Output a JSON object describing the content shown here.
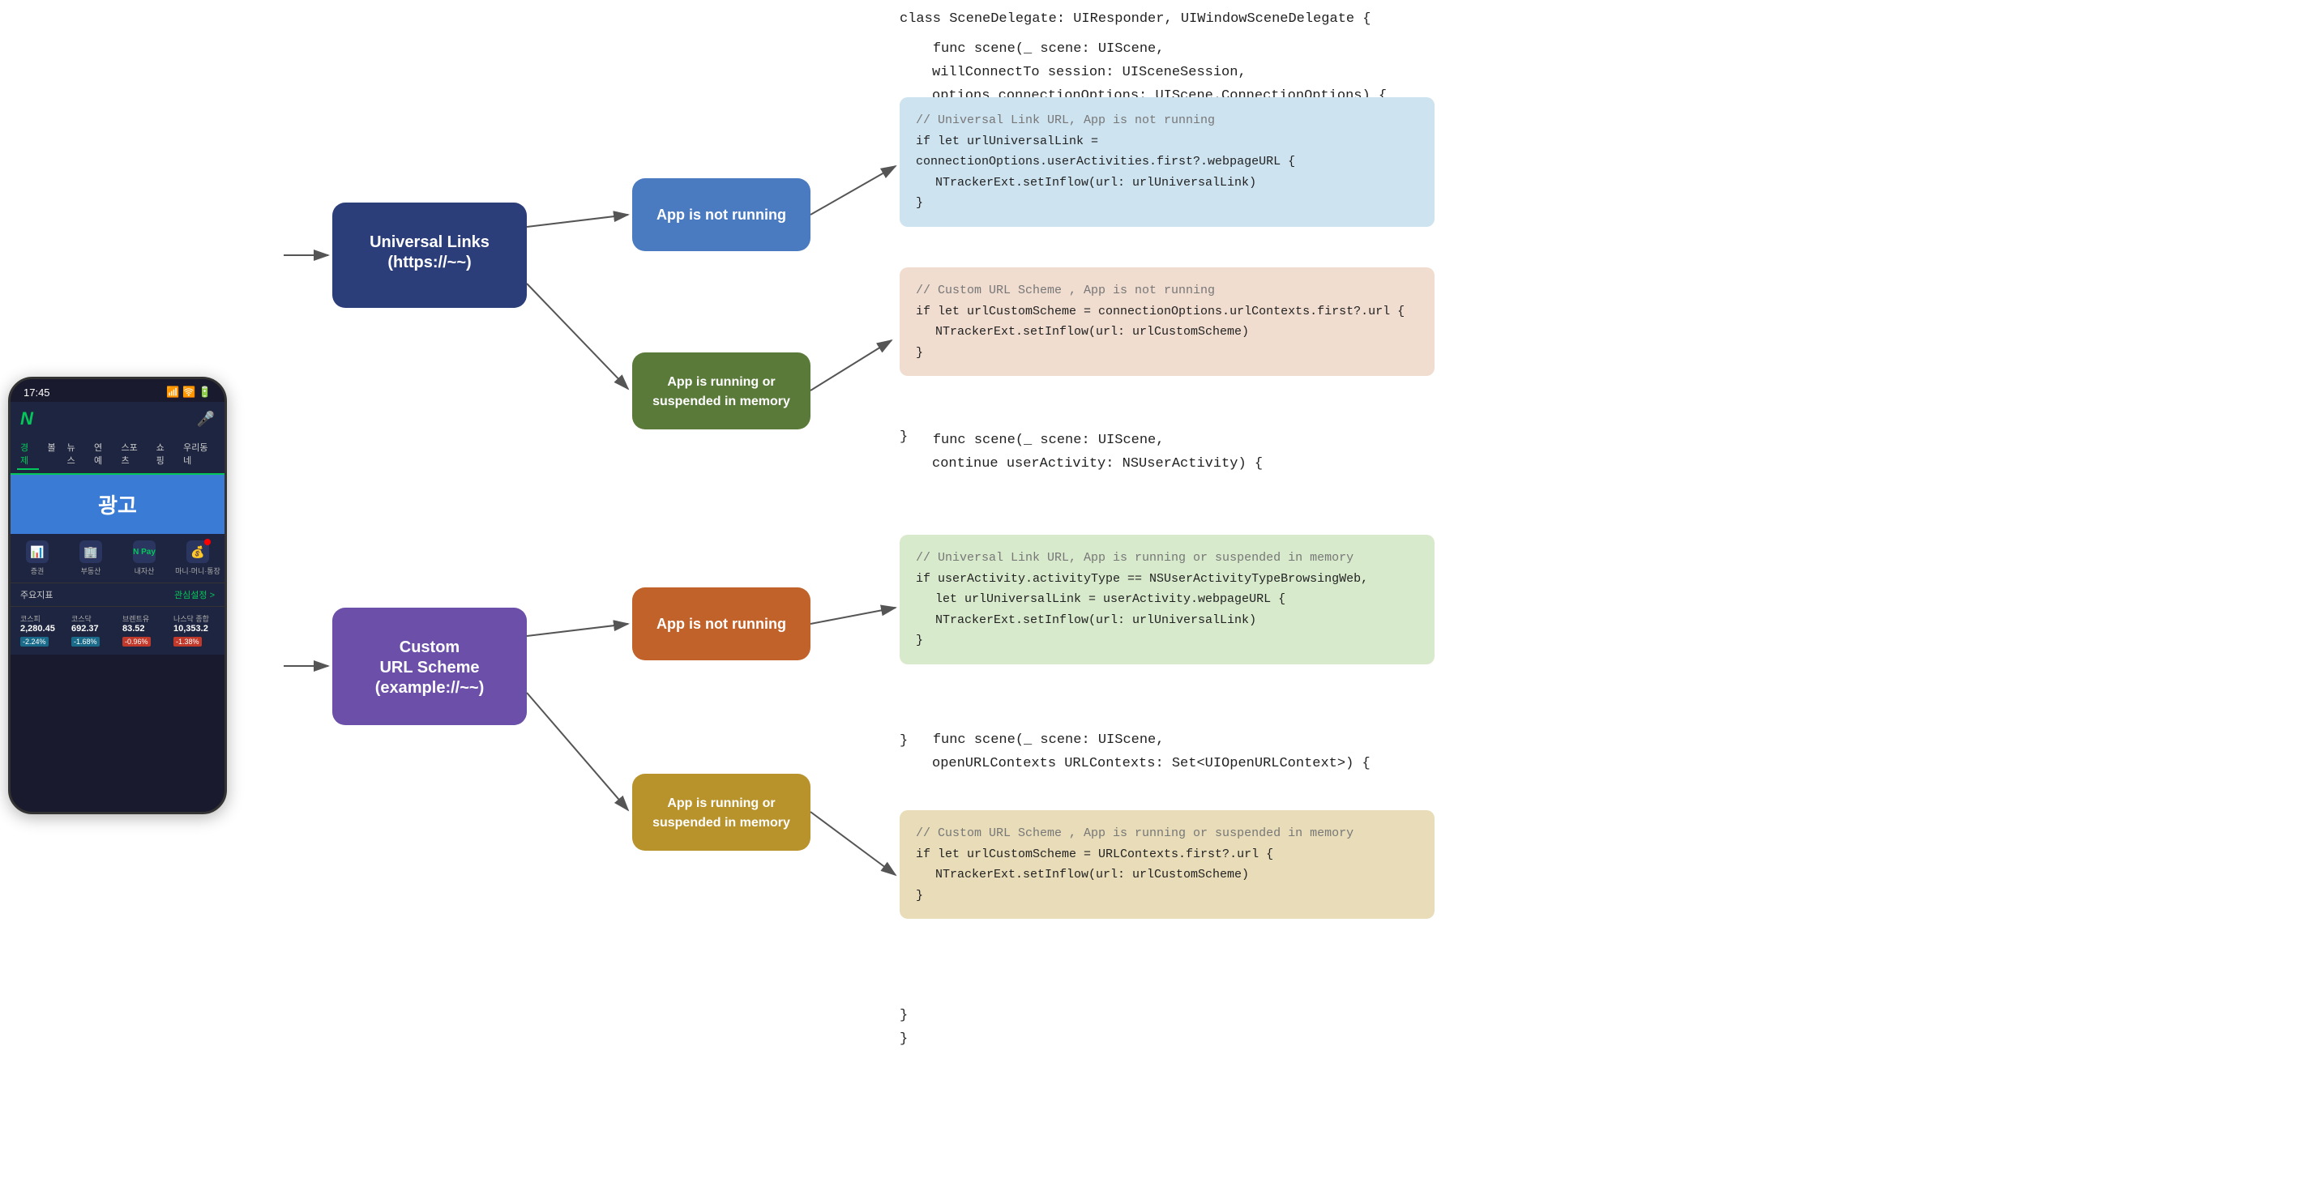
{
  "phone": {
    "time": "17:45",
    "logo": "N",
    "menu_items": [
      "경제",
      "볼",
      "뉴스",
      "연예",
      "스포츠",
      "쇼핑",
      "우리동네",
      "≡"
    ],
    "ad_text": "광고",
    "icons": [
      {
        "label": "증권",
        "icon": "📊"
      },
      {
        "label": "부동산",
        "icon": "🏢"
      },
      {
        "label": "내자산",
        "icon": "💳"
      },
      {
        "label": "마니·머니·통장",
        "icon": "💰",
        "badge": true
      }
    ],
    "section_title": "주요지표",
    "section_action": "관심설정 >",
    "stocks": [
      {
        "name": "코스피",
        "value": "2,280.45",
        "change": "-2.24%",
        "type": "negative"
      },
      {
        "name": "코스닥",
        "value": "692.37",
        "change": "-1.68%",
        "type": "negative"
      },
      {
        "name": "브렌트유",
        "value": "83.52",
        "change": "-0.96%",
        "type": "more-negative"
      },
      {
        "name": "나스닥 종합",
        "value": "10,353.2",
        "change": "-1.38%",
        "type": "more-negative"
      }
    ]
  },
  "diagram": {
    "nodes": {
      "universal_links": "Universal Links\n(https://~~)",
      "custom_url": "Custom\nURL Scheme\n(example://~~)",
      "not_running_1": "App is not running",
      "running_1": "App is running or\nsuspended in memory",
      "not_running_2": "App is not running",
      "running_2": "App is running or\nsuspended in memory"
    }
  },
  "code": {
    "class_header": "class SceneDelegate: UIResponder, UIWindowSceneDelegate {",
    "func1_header": "func scene(_ scene: UIScene,",
    "func1_param1": "             willConnectTo session: UISceneSession,",
    "func1_param2": "             options connectionOptions: UIScene.ConnectionOptions) {",
    "panel1_comment": "// Universal Link URL, App is not running",
    "panel1_line1": "if let urlUniversalLink = connectionOptions.userActivities.first?.webpageURL {",
    "panel1_line2": "    NTrackerExt.setInflow(url: urlUniversalLink)",
    "panel1_line3": "}",
    "panel2_comment": "// Custom URL Scheme , App is not running",
    "panel2_line1": "if let urlCustomScheme = connectionOptions.urlContexts.first?.url {",
    "panel2_line2": "    NTrackerExt.setInflow(url: urlCustomScheme)",
    "panel2_line3": "}",
    "close_brace_1": "}",
    "func2_header": "func scene(_ scene: UIScene,",
    "func2_param1": "         continue userActivity: NSUserActivity) {",
    "panel3_comment": "// Universal Link URL, App is running or suspended in memory",
    "panel3_line1": "if userActivity.activityType == NSUserActivityTypeBrowsingWeb,",
    "panel3_line2": "   let urlUniversalLink = userActivity.webpageURL {",
    "panel3_line3": "    NTrackerExt.setInflow(url: urlUniversalLink)",
    "panel3_line4": "}",
    "close_brace_2": "}",
    "func3_header": "func scene(_ scene: UIScene,",
    "func3_param1": "          openURLContexts URLContexts: Set<UIOpenURLContext>) {",
    "panel4_comment": "// Custom URL Scheme , App is running or suspended in memory",
    "panel4_line1": "if let urlCustomScheme = URLContexts.first?.url {",
    "panel4_line2": "    NTrackerExt.setInflow(url: urlCustomScheme)",
    "panel4_line3": "}",
    "close_brace_3": "}",
    "close_brace_4": "}"
  }
}
